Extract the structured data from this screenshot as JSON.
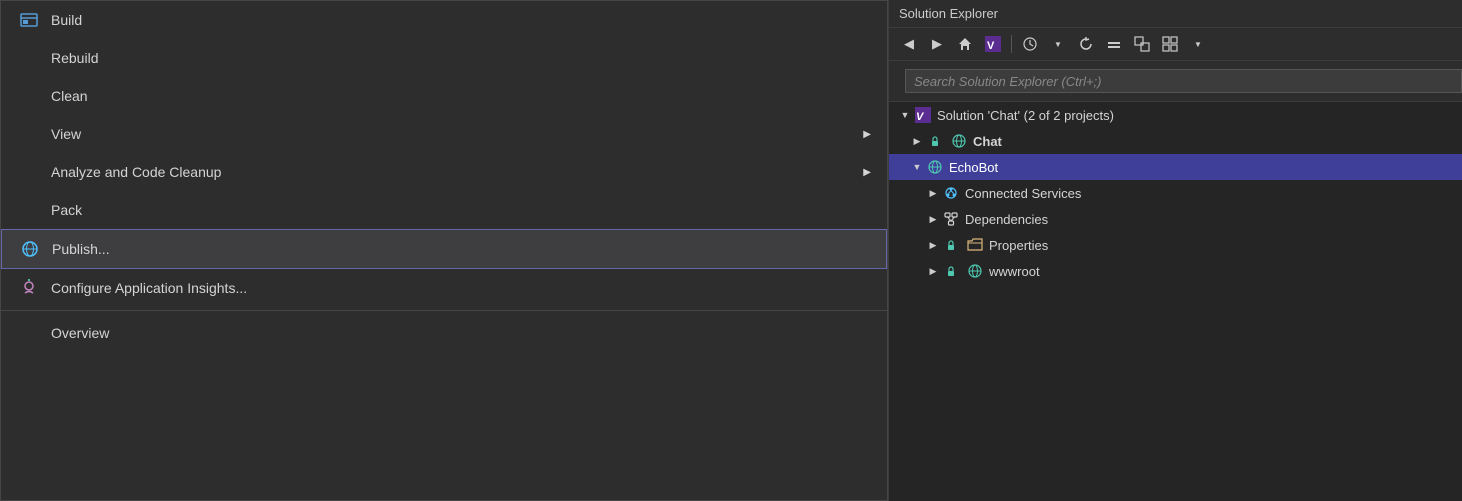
{
  "menu": {
    "items": [
      {
        "id": "build",
        "label": "Build",
        "hasIcon": true,
        "iconType": "build",
        "hasArrow": false,
        "highlighted": false,
        "separator": false
      },
      {
        "id": "rebuild",
        "label": "Rebuild",
        "hasIcon": false,
        "hasArrow": false,
        "highlighted": false,
        "separator": false
      },
      {
        "id": "clean",
        "label": "Clean",
        "hasIcon": false,
        "hasArrow": false,
        "highlighted": false,
        "separator": false
      },
      {
        "id": "view",
        "label": "View",
        "hasIcon": false,
        "hasArrow": true,
        "highlighted": false,
        "separator": false
      },
      {
        "id": "analyze",
        "label": "Analyze and Code Cleanup",
        "hasIcon": false,
        "hasArrow": true,
        "highlighted": false,
        "separator": false
      },
      {
        "id": "pack",
        "label": "Pack",
        "hasIcon": false,
        "hasArrow": false,
        "highlighted": false,
        "separator": false
      },
      {
        "id": "publish",
        "label": "Publish...",
        "hasIcon": true,
        "iconType": "globe",
        "hasArrow": false,
        "highlighted": true,
        "separator": false
      },
      {
        "id": "configure",
        "label": "Configure Application Insights...",
        "hasIcon": true,
        "iconType": "insights",
        "hasArrow": false,
        "highlighted": false,
        "separator": true
      },
      {
        "id": "overview",
        "label": "Overview",
        "hasIcon": false,
        "hasArrow": false,
        "highlighted": false,
        "separator": false
      }
    ]
  },
  "solution_explorer": {
    "title": "Solution Explorer",
    "toolbar": {
      "buttons": [
        "◀",
        "▶",
        "🏠",
        "⬛",
        "🕐",
        "▼",
        "↺",
        "—",
        "⬜",
        "⧉",
        "⊞",
        "▼"
      ]
    },
    "search_placeholder": "Search Solution Explorer (Ctrl+;)",
    "tree": [
      {
        "id": "solution",
        "level": 0,
        "label": "Solution 'Chat' (2 of 2 projects)",
        "iconType": "vs",
        "expanded": true,
        "selected": false,
        "bold": false,
        "hasLock": false
      },
      {
        "id": "chat",
        "level": 1,
        "label": "Chat",
        "iconType": "globe-cyan",
        "expanded": false,
        "selected": false,
        "bold": true,
        "hasLock": true
      },
      {
        "id": "echobot",
        "level": 1,
        "label": "EchoBot",
        "iconType": "globe-cyan",
        "expanded": true,
        "selected": true,
        "bold": false,
        "hasLock": false
      },
      {
        "id": "connected-services",
        "level": 2,
        "label": "Connected Services",
        "iconType": "connected",
        "expanded": false,
        "selected": false,
        "bold": false,
        "hasLock": false
      },
      {
        "id": "dependencies",
        "level": 2,
        "label": "Dependencies",
        "iconType": "deps",
        "expanded": false,
        "selected": false,
        "bold": false,
        "hasLock": false
      },
      {
        "id": "properties",
        "level": 2,
        "label": "Properties",
        "iconType": "props",
        "expanded": false,
        "selected": false,
        "bold": false,
        "hasLock": true
      },
      {
        "id": "wwwroot",
        "level": 2,
        "label": "wwwroot",
        "iconType": "folder",
        "expanded": false,
        "selected": false,
        "bold": false,
        "hasLock": true
      }
    ]
  }
}
